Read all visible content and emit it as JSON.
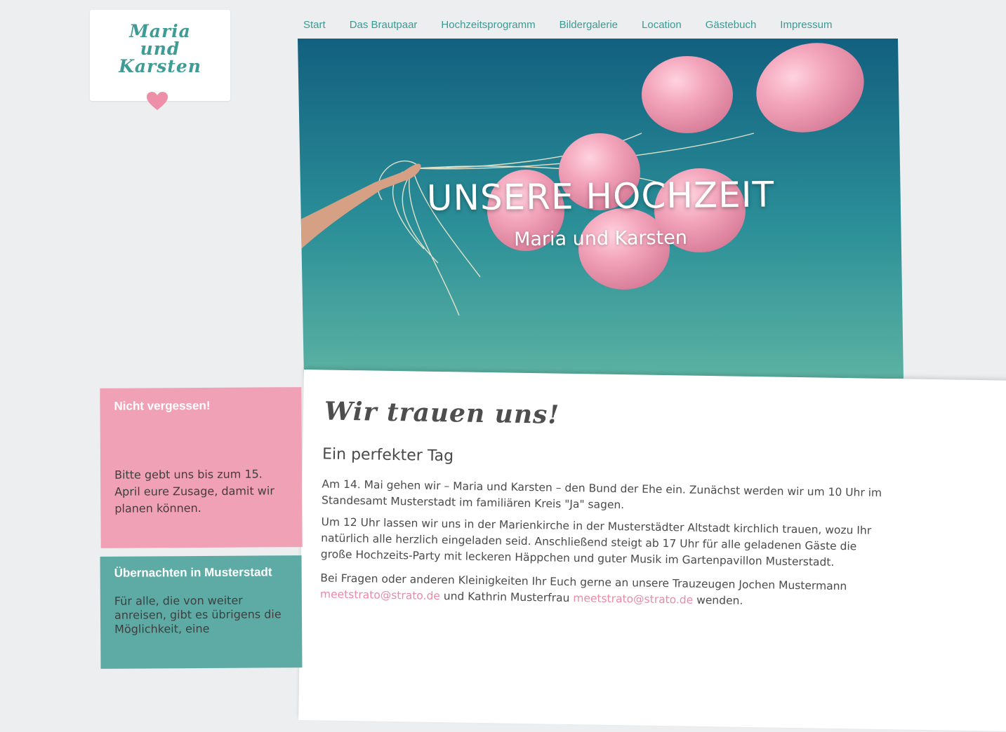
{
  "logo": {
    "line1": "Maria",
    "line2": "und",
    "line3": "Karsten"
  },
  "nav": {
    "items": [
      "Start",
      "Das Brautpaar",
      "Hochzeitsprogramm",
      "Bildergalerie",
      "Location",
      "Gästebuch",
      "Impressum"
    ]
  },
  "hero": {
    "title": "UNSERE HOCHZEIT",
    "subtitle": "Maria und Karsten"
  },
  "main": {
    "heading": "Wir trauen uns!",
    "subheading": "Ein perfekter Tag",
    "p1": "Am 14. Mai gehen wir – Maria und Karsten – den Bund der Ehe ein. Zunächst werden wir um 10 Uhr im Standesamt Musterstadt im familiären Kreis \"Ja\" sagen.",
    "p2": "Um 12 Uhr lassen wir uns in der Marienkirche in der Musterstädter Altstadt kirchlich trauen, wozu Ihr natürlich alle herzlich eingeladen seid. Anschließend steigt ab 17 Uhr für alle geladenen Gäste die große Hochzeits-Party mit leckeren Häppchen und guter Musik im Gartenpavillon Musterstadt.",
    "p3_a": "Bei Fragen oder anderen Kleinigkeiten Ihr Euch gerne an unsere Trauzeugen Jochen Mustermann",
    "email1": "meetstrato@strato.de",
    "p3_b": "und Kathrin Musterfrau",
    "email2": "meetstrato@strato.de",
    "p3_c": "wenden."
  },
  "sidebar": {
    "box1": {
      "title": "Nicht vergessen!",
      "text": "Bitte gebt uns bis zum 15. April eure Zusage, damit wir planen können."
    },
    "box2": {
      "title": "Übernachten in Musterstadt",
      "text": "Für alle, die von weiter anreisen, gibt es übrigens die Möglichkeit, eine"
    }
  },
  "colors": {
    "accent_teal": "#3a9a94",
    "accent_pink": "#f0a1b5",
    "box_teal": "#5eaba5",
    "link_pink": "#ea8aa6"
  },
  "icons": {
    "heart": "heart-icon"
  }
}
